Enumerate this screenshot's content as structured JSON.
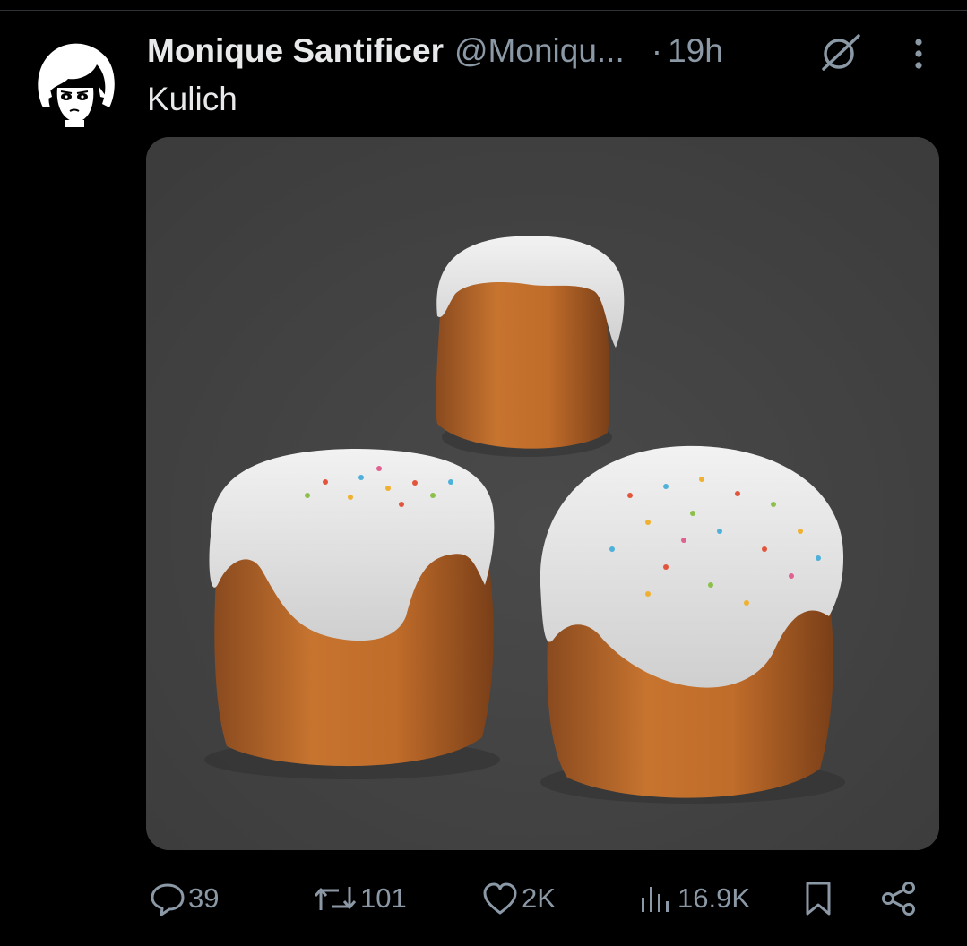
{
  "tweet": {
    "author": {
      "display_name": "Monique Santificer",
      "handle": "@Moniqu...",
      "avatar_icon": "cartoon-girl-avatar"
    },
    "separator": "·",
    "time": "19h",
    "text": "Kulich",
    "media": {
      "background_color": "#434343",
      "depicted": "three kulich cakes with white icing and colored sprinkles"
    },
    "actions": {
      "replies": "39",
      "reposts": "101",
      "likes": "2K",
      "views": "16.9K"
    },
    "icons": {
      "grok": "grok-icon",
      "more": "more-options-icon",
      "reply": "reply-icon",
      "repost": "repost-icon",
      "like": "heart-icon",
      "views": "views-icon",
      "bookmark": "bookmark-icon",
      "share": "share-icon"
    }
  },
  "colors": {
    "background": "#000000",
    "text_primary": "#e7e9ea",
    "text_secondary": "#8b98a5"
  }
}
